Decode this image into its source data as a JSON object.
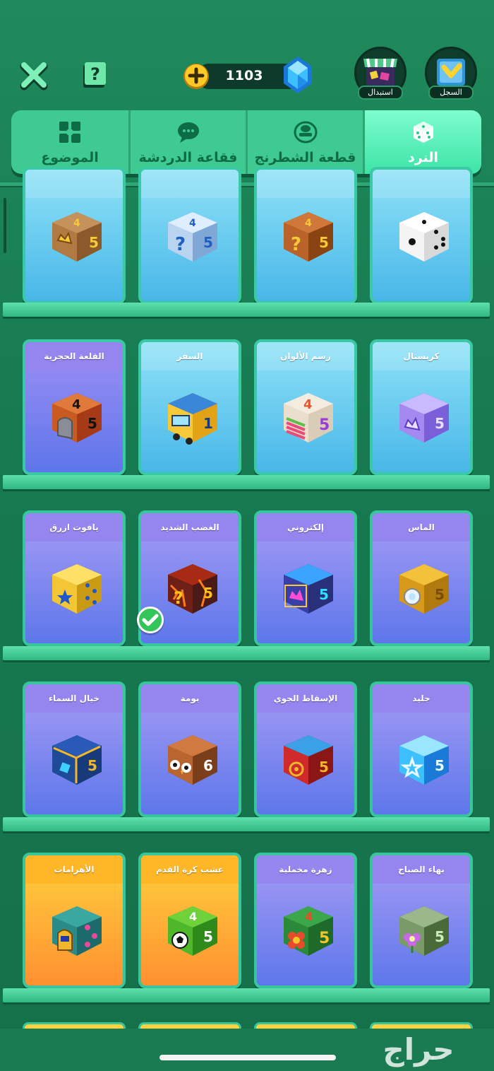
{
  "header": {
    "close_icon": "close-x-icon",
    "help_icon": "help-question-icon",
    "coins_amount": "1103",
    "exchange_label": "استبدال",
    "history_label": "السجل"
  },
  "tabs": [
    {
      "label": "الموضوع",
      "icon": "theme-grid-icon",
      "active": false
    },
    {
      "label": "فقاعة الدردشة",
      "icon": "chat-bubble-icon",
      "active": false
    },
    {
      "label": "قطعة الشطرنج",
      "icon": "chess-piece-icon",
      "active": false
    },
    {
      "label": "النرد",
      "icon": "dice-icon",
      "active": true
    }
  ],
  "colors": {
    "background": "#1d7d55",
    "tab_active": "#4ee8ad",
    "card_blue": "#5ec4ef",
    "card_purple": "#6f80ec",
    "card_orange": "#ffa833",
    "selected_check": "#34c55a"
  },
  "grid": {
    "rows": [
      {
        "items": [
          {
            "title": "",
            "die": "crown-wood-dice"
          },
          {
            "title": "",
            "die": "mystery-ice-dice"
          },
          {
            "title": "",
            "die": "mystery-crate-dice"
          },
          {
            "title": "",
            "die": "classic-white-dice"
          }
        ]
      },
      {
        "items": [
          {
            "title": "القلعة الحجرية",
            "die": "stone-castle-dice"
          },
          {
            "title": "السفر",
            "die": "travel-bus-dice"
          },
          {
            "title": "رسم الألوان",
            "die": "paint-dice"
          },
          {
            "title": "كريستال",
            "die": "crystal-dice"
          }
        ]
      },
      {
        "items": [
          {
            "title": "يافوت ازرق",
            "die": "blue-sapphire-dice"
          },
          {
            "title": "الغضب الشديد",
            "die": "lava-dice",
            "selected": true
          },
          {
            "title": "إلكتروني",
            "die": "electronic-dice"
          },
          {
            "title": "الماس",
            "die": "diamond-dice"
          }
        ]
      },
      {
        "items": [
          {
            "title": "خيال السماء",
            "die": "sky-fantasy-dice"
          },
          {
            "title": "بومة",
            "die": "owl-dice"
          },
          {
            "title": "الإسقاط الجوي",
            "die": "airdrop-dice"
          },
          {
            "title": "جليد",
            "die": "ice-dice"
          }
        ]
      },
      {
        "items": [
          {
            "title": "الأهرامات",
            "die": "pyramids-dice"
          },
          {
            "title": "عشب كرة القدم",
            "die": "football-grass-dice"
          },
          {
            "title": "زهرة مخملية",
            "die": "velvet-flower-dice"
          },
          {
            "title": "بهاء الصباح",
            "die": "morning-glory-dice"
          }
        ]
      }
    ]
  },
  "watermark": "حراج"
}
